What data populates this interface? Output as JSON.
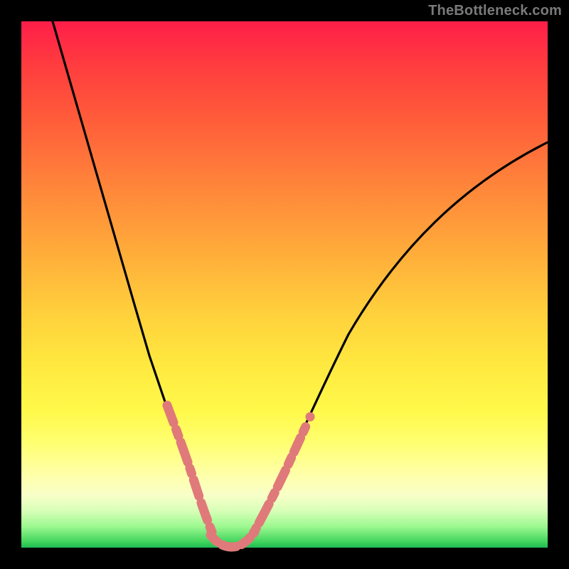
{
  "watermark": "TheBottleneck.com",
  "chart_data": {
    "type": "line",
    "title": "",
    "xlabel": "",
    "ylabel": "",
    "xlim": [
      0,
      100
    ],
    "ylim": [
      0,
      100
    ],
    "grid": false,
    "legend": false,
    "series": [
      {
        "name": "bottleneck-curve",
        "color": "#000000",
        "x": [
          6,
          8,
          10,
          12,
          14,
          16,
          18,
          20,
          22,
          24,
          25,
          26,
          27,
          28,
          29,
          30,
          31,
          32,
          33,
          34,
          35,
          36,
          38,
          40,
          42,
          45,
          48,
          52,
          56,
          60,
          65,
          70,
          75,
          80,
          85,
          90,
          95,
          100
        ],
        "y": [
          100,
          92,
          84,
          76,
          69,
          62,
          55,
          49,
          43,
          37,
          34,
          31,
          28,
          25,
          22,
          19,
          15,
          11,
          7,
          4,
          2,
          1,
          0,
          0,
          1,
          3,
          7,
          13,
          20,
          27,
          35,
          43,
          50,
          57,
          63,
          68,
          73,
          77
        ]
      },
      {
        "name": "highlight-band-left",
        "color": "#e07a7a",
        "style": "thick-dashed",
        "x": [
          25,
          26,
          27,
          28,
          29,
          30,
          31,
          32,
          33,
          34,
          35
        ],
        "y": [
          34,
          31,
          28,
          25,
          22,
          19,
          15,
          11,
          7,
          4,
          2
        ]
      },
      {
        "name": "highlight-band-bottom",
        "color": "#e07a7a",
        "style": "thick-dashed",
        "x": [
          35,
          36,
          37,
          38,
          39,
          40,
          41,
          42,
          43,
          44
        ],
        "y": [
          2,
          1,
          0.5,
          0,
          0,
          0,
          0.3,
          1,
          1.8,
          2.5
        ]
      },
      {
        "name": "highlight-band-right",
        "color": "#e07a7a",
        "style": "thick-dashed",
        "x": [
          44,
          45,
          46,
          47,
          48,
          49,
          50,
          51,
          52,
          53
        ],
        "y": [
          2.5,
          3,
          4.2,
          5.6,
          7,
          8.5,
          10,
          11.5,
          13,
          14.5
        ]
      }
    ],
    "annotations": []
  },
  "colors": {
    "curve": "#000000",
    "highlight": "#e07a7a",
    "frame": "#000000"
  }
}
